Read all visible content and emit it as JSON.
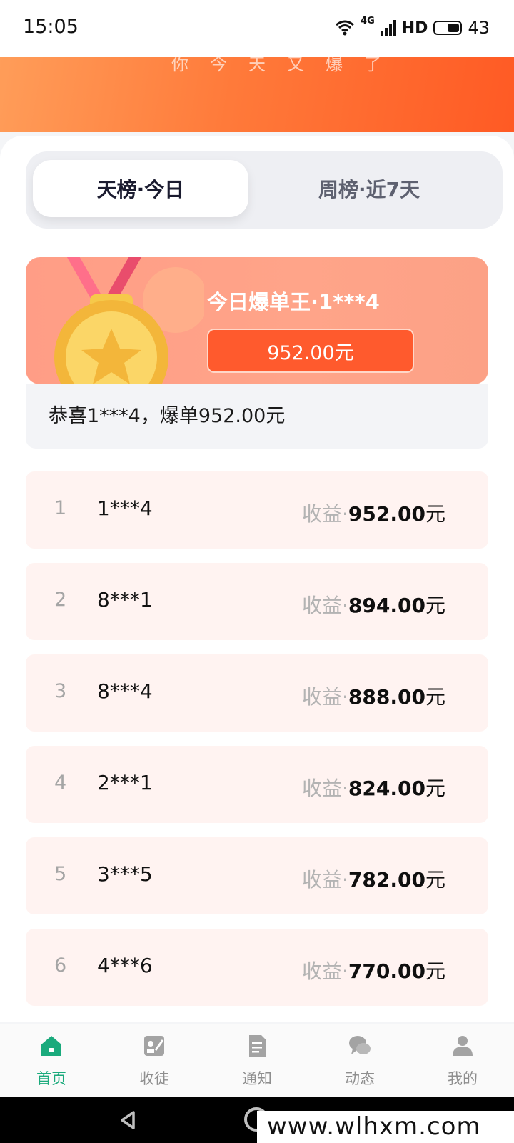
{
  "status_bar": {
    "time": "15:05",
    "network": "4G",
    "hd": "HD",
    "battery": "43"
  },
  "banner": {
    "text": "你今天又爆了"
  },
  "tabs": [
    {
      "label": "天榜·今日",
      "active": true
    },
    {
      "label": "周榜·近7天",
      "active": false
    }
  ],
  "hero": {
    "title": "今日爆单王·1***4",
    "amount": "952.00元"
  },
  "congrats": "恭喜1***4，爆单952.00元",
  "ranking": [
    {
      "rank": "1",
      "user": "1***4",
      "label": "收益·",
      "amount": "952.00",
      "unit": "元"
    },
    {
      "rank": "2",
      "user": "8***1",
      "label": "收益·",
      "amount": "894.00",
      "unit": "元"
    },
    {
      "rank": "3",
      "user": "8***4",
      "label": "收益·",
      "amount": "888.00",
      "unit": "元"
    },
    {
      "rank": "4",
      "user": "2***1",
      "label": "收益·",
      "amount": "824.00",
      "unit": "元"
    },
    {
      "rank": "5",
      "user": "3***5",
      "label": "收益·",
      "amount": "782.00",
      "unit": "元"
    },
    {
      "rank": "6",
      "user": "4***6",
      "label": "收益·",
      "amount": "770.00",
      "unit": "元"
    }
  ],
  "nav": [
    {
      "label": "首页",
      "icon": "home-icon",
      "active": true
    },
    {
      "label": "收徒",
      "icon": "apprentice-icon",
      "active": false
    },
    {
      "label": "通知",
      "icon": "notice-icon",
      "active": false
    },
    {
      "label": "动态",
      "icon": "chat-icon",
      "active": false
    },
    {
      "label": "我的",
      "icon": "user-icon",
      "active": false
    }
  ],
  "watermark": "www.wlhxm.com",
  "colors": {
    "accent": "#ff5a2d",
    "nav_active": "#1aaa7c"
  }
}
